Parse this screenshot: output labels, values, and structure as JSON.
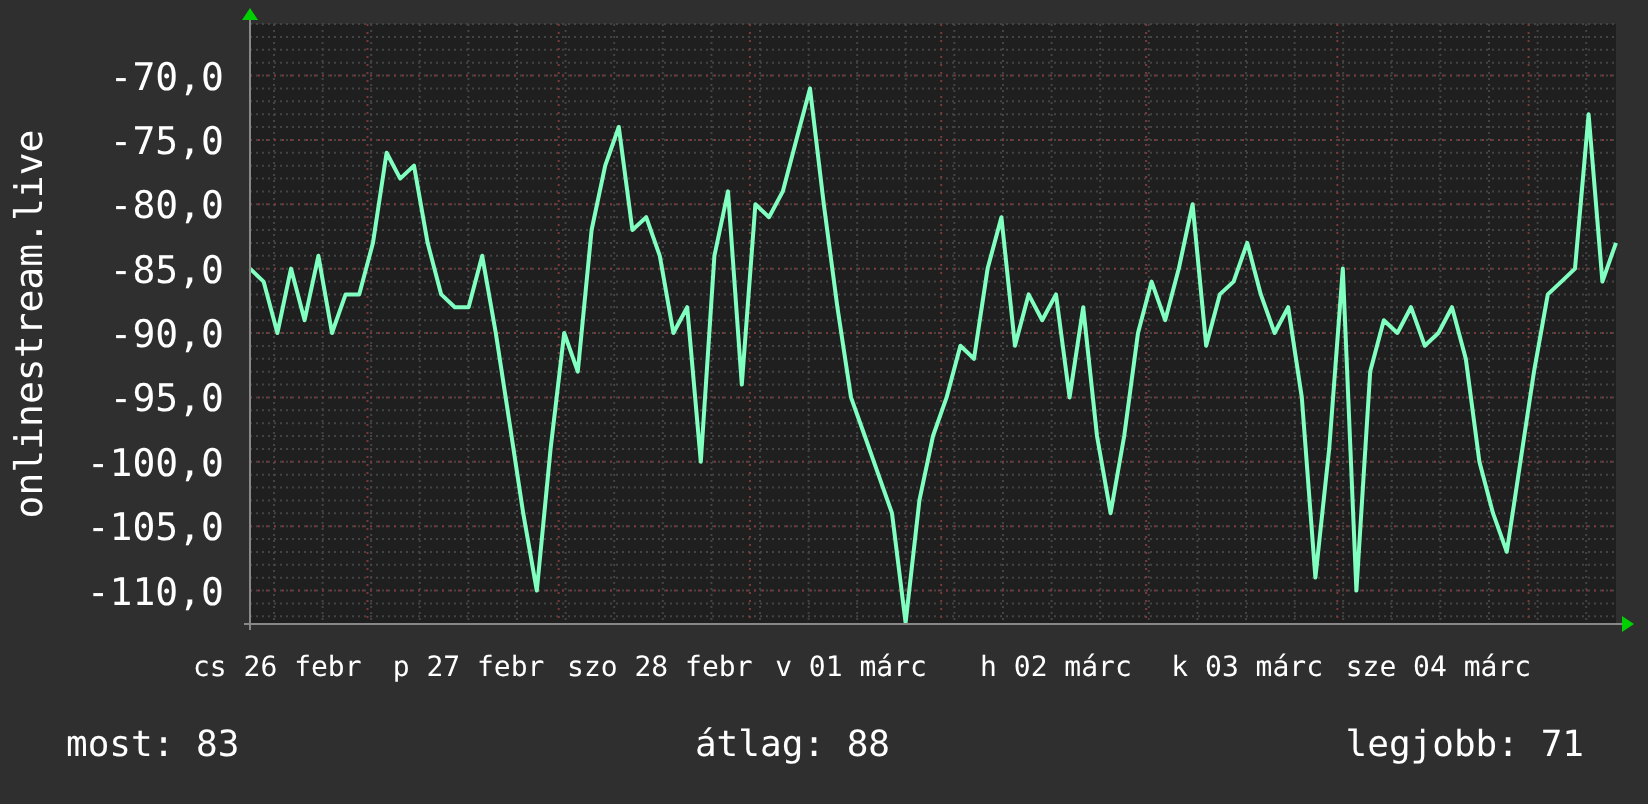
{
  "graph": {
    "chart_data": {
      "type": "line",
      "ylabel": "onlinestream.live",
      "ylim": [
        -112.6,
        -66
      ],
      "yticks": [
        {
          "value": -110,
          "label": "-110,0"
        },
        {
          "value": -105,
          "label": "-105,0"
        },
        {
          "value": -100,
          "label": "-100,0"
        },
        {
          "value": -95,
          "label": "-95,0"
        },
        {
          "value": -90,
          "label": "-90,0"
        },
        {
          "value": -85,
          "label": "-85,0"
        },
        {
          "value": -80,
          "label": "-80,0"
        },
        {
          "value": -75,
          "label": "-75,0"
        },
        {
          "value": -70,
          "label": "-70,0"
        }
      ],
      "grid": true,
      "categories": [
        null,
        null,
        "cs 26 febr",
        null,
        null,
        null,
        null,
        null,
        null,
        null,
        null,
        null,
        null,
        null,
        null,
        null,
        "p 27 febr",
        null,
        null,
        null,
        null,
        null,
        null,
        null,
        null,
        null,
        null,
        null,
        null,
        null,
        "szo 28 febr",
        null,
        null,
        null,
        null,
        null,
        null,
        null,
        null,
        null,
        null,
        null,
        null,
        null,
        "v 01 márc",
        null,
        null,
        null,
        null,
        null,
        null,
        null,
        null,
        null,
        null,
        null,
        null,
        null,
        null,
        "h 02 márc",
        null,
        null,
        null,
        null,
        null,
        null,
        null,
        null,
        null,
        null,
        null,
        null,
        null,
        "k 03 márc",
        null,
        null,
        null,
        null,
        null,
        null,
        null,
        null,
        null,
        null,
        null,
        null,
        null,
        "sze 04 márc",
        null,
        null,
        null,
        null,
        null,
        null,
        null,
        null,
        null,
        null,
        null,
        null,
        null
      ],
      "series": [
        {
          "color": "#80ffc0",
          "values": [
            -85,
            -86,
            -90,
            -85,
            -89,
            -84,
            -90,
            -87,
            -87,
            -83,
            -76,
            -78,
            -77,
            -83,
            -87,
            -88,
            -88,
            -84,
            -90,
            -97,
            -104,
            -110,
            -99,
            -90,
            -93,
            -82,
            -77,
            -74,
            -82,
            -81,
            -84,
            -90,
            -88,
            -100,
            -84,
            -79,
            -94,
            -80,
            -81,
            -79,
            -75,
            -71,
            -80,
            -88,
            -95,
            -98,
            -101,
            -104,
            -112.5,
            -103,
            -98,
            -95,
            -91,
            -92,
            -85,
            -81,
            -91,
            -87,
            -89,
            -87,
            -95,
            -88,
            -98,
            -104,
            -98,
            -90,
            -86,
            -89,
            -85,
            -80,
            -91,
            -87,
            -86,
            -83,
            -87,
            -90,
            -88,
            -95,
            -109,
            -99,
            -85,
            -110,
            -93,
            -89,
            -90,
            -88,
            -91,
            -90,
            -88,
            -92,
            -100,
            -104,
            -107,
            -100,
            -93,
            -87,
            -86,
            -85,
            -73,
            -86,
            -83
          ]
        }
      ]
    }
  },
  "legend": [
    {
      "label": "most: 83"
    },
    {
      "label": "átlag: 88"
    },
    {
      "label": "legjobb: 71"
    }
  ]
}
